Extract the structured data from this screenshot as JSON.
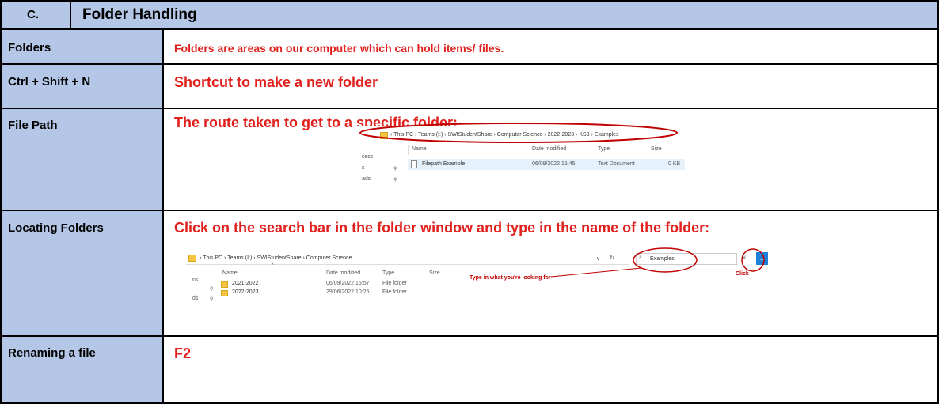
{
  "header": {
    "section_letter": "C.",
    "title": "Folder Handling"
  },
  "rows": [
    {
      "label": "Folders",
      "text": "Folders are areas on our computer which can hold items/ files."
    },
    {
      "label": "Ctrl + Shift + N",
      "text": "Shortcut to make a new folder"
    },
    {
      "label": "File Path",
      "text": "The route taken to get to a specific folder:"
    },
    {
      "label": "Locating Folders",
      "text": "Click on the search bar in the folder window and type in the name of the folder:"
    },
    {
      "label": "Renaming a file",
      "text": "F2"
    }
  ],
  "explorer1": {
    "breadcrumb": [
      "This PC",
      "Teams (I:)",
      "SWIStudentShare",
      "Computer Science",
      "2022-2023",
      "KS3",
      "Examples"
    ],
    "columns": [
      "Name",
      "Date modified",
      "Type",
      "Size"
    ],
    "file": {
      "name": "Filepath Example",
      "date": "06/09/2022 15:45",
      "type": "Text Document",
      "size": "0 KB"
    },
    "side_items": [
      "cess",
      "s",
      "ads"
    ]
  },
  "explorer2": {
    "breadcrumb": [
      "This PC",
      "Teams (I:)",
      "SWIStudentShare",
      "Computer Science"
    ],
    "search_value": "Examples",
    "columns": [
      "Name",
      "Date modified",
      "Type",
      "Size"
    ],
    "rows": [
      {
        "name": "2021-2022",
        "date": "06/09/2022 15:57",
        "type": "File folder"
      },
      {
        "name": "2022-2023",
        "date": "29/06/2022 10:25",
        "type": "File folder"
      }
    ],
    "side_items": [
      "ns",
      "ds"
    ],
    "annotation_search": "Type in what you're looking for",
    "annotation_click": "Click"
  },
  "colors": {
    "header_fill": "#b4c7e7",
    "red": "#e0201c"
  }
}
